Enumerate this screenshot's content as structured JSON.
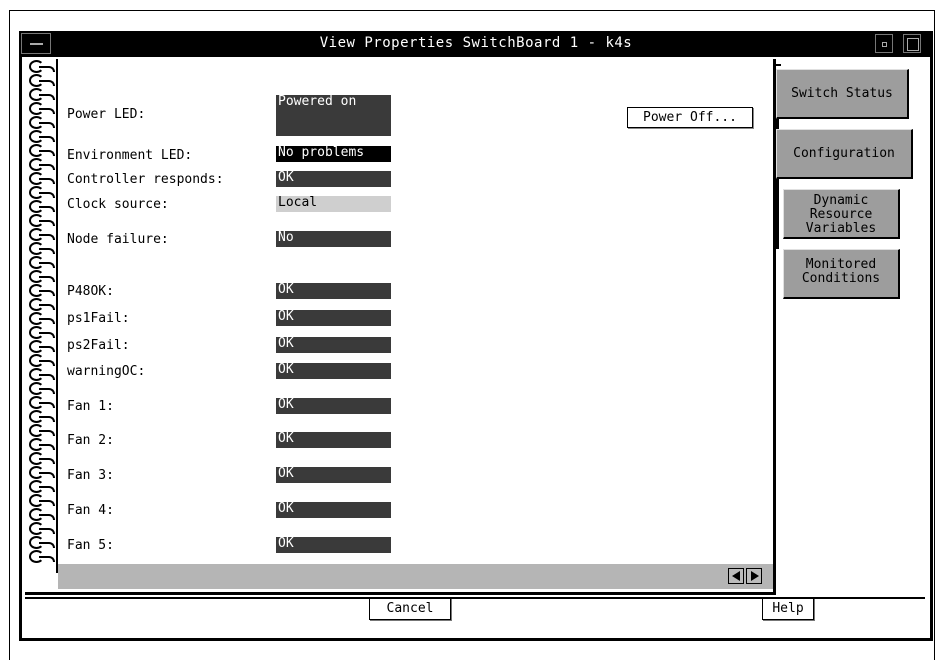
{
  "window": {
    "title": "View Properties SwitchBoard 1 - k4s"
  },
  "properties": [
    {
      "label": "Power LED:",
      "value": "Powered on",
      "style": "tall"
    },
    {
      "label": "Environment LED:",
      "value": "No problems",
      "style": "black"
    },
    {
      "label": "Controller responds:",
      "value": "OK",
      "style": "dark"
    },
    {
      "label": "Clock source:",
      "value": "Local",
      "style": "light"
    },
    {
      "label": "Node failure:",
      "value": "No",
      "style": "dark"
    },
    {
      "label": "P48OK:",
      "value": "OK",
      "style": "dark"
    },
    {
      "label": "ps1Fail:",
      "value": "OK",
      "style": "dark"
    },
    {
      "label": "ps2Fail:",
      "value": "OK",
      "style": "dark"
    },
    {
      "label": "warningOC:",
      "value": "OK",
      "style": "dark"
    },
    {
      "label": "Fan 1:",
      "value": "OK",
      "style": "dark"
    },
    {
      "label": "Fan 2:",
      "value": "OK",
      "style": "dark"
    },
    {
      "label": "Fan 3:",
      "value": "OK",
      "style": "dark"
    },
    {
      "label": "Fan 4:",
      "value": "OK",
      "style": "dark"
    },
    {
      "label": "Fan 5:",
      "value": "OK",
      "style": "dark"
    }
  ],
  "actions": {
    "power_off": "Power Off..."
  },
  "tabs": [
    {
      "label": "Switch Status"
    },
    {
      "label": "Configuration"
    },
    {
      "label": "Dynamic\nResource\nVariables"
    },
    {
      "label": "Monitored\nConditions"
    }
  ],
  "footer": {
    "cancel": "Cancel",
    "help": "Help"
  },
  "icons": {
    "window_menu": "window-menu-icon",
    "minimize": "minimize-icon",
    "maximize": "maximize-icon",
    "scroll_left": "arrow-left-icon",
    "scroll_right": "arrow-right-icon",
    "binder": "spiral-binding-icon"
  },
  "colors": {
    "field_dark": "#3a3a3a",
    "field_light": "#cfcfcf",
    "tab": "#9d9d9d",
    "scrollbar": "#b5b5b5"
  }
}
